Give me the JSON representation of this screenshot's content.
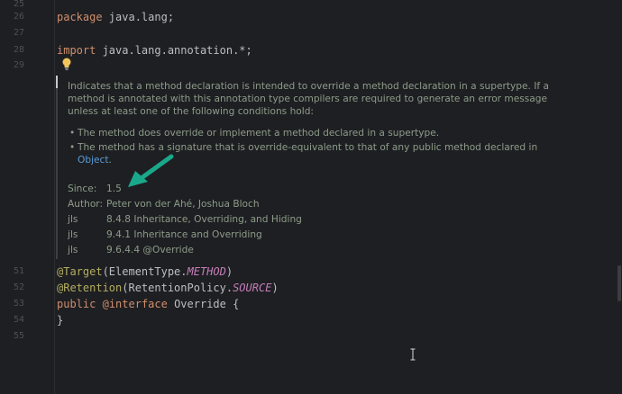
{
  "gutter": {
    "line_numbers": [
      "25",
      "26",
      "27",
      "28",
      "29",
      "51",
      "52",
      "53",
      "54",
      "55"
    ]
  },
  "code": {
    "line26": {
      "kw": "package",
      "rest": " java.lang;"
    },
    "line28": {
      "kw": "import",
      "rest": " java.lang.annotation.*;"
    },
    "line51": {
      "ann": "@Target",
      "open": "(ElementType.",
      "const": "METHOD",
      "close": ")"
    },
    "line52": {
      "ann": "@Retention",
      "open": "(RetentionPolicy.",
      "const": "SOURCE",
      "close": ")"
    },
    "line53": {
      "kw1": "public",
      "kw2": "@interface",
      "rest": " Override {"
    },
    "line54": {
      "text": "}"
    }
  },
  "doc": {
    "summary_lines": [
      "Indicates that a method declaration is intended to override a method declaration in a supertype. If a",
      "method is annotated with this annotation type compilers are required to generate an error message",
      "unless at least one of the following conditions hold:"
    ],
    "bullets": [
      "The method does override or implement a method declared in a supertype.",
      "The method has a signature that is override-equivalent to that of any public method declared in"
    ],
    "bullet_link": "Object",
    "bullet_link_suffix": ".",
    "tags": [
      {
        "key": "Since:",
        "value": "1.5"
      },
      {
        "key": "Author:",
        "value": "Peter von der Ahé, Joshua Bloch"
      },
      {
        "key": "jls",
        "value": "8.4.8 Inheritance, Overriding, and Hiding"
      },
      {
        "key": "jls",
        "value": "9.4.1 Inheritance and Overriding"
      },
      {
        "key": "jls",
        "value": "9.6.4.4 @Override"
      }
    ]
  },
  "colors": {
    "background": "#1e1f22",
    "keyword": "#cf8e6d",
    "annotation": "#b3ae60",
    "constant": "#c77dbb",
    "doc_text": "#8d9c8a",
    "link": "#5a9bd6",
    "arrow": "#1aa88a"
  },
  "icons": {
    "bulb": "lightbulb-icon",
    "arrow": "annotation-arrow-icon",
    "cursor": "text-cursor-icon"
  }
}
